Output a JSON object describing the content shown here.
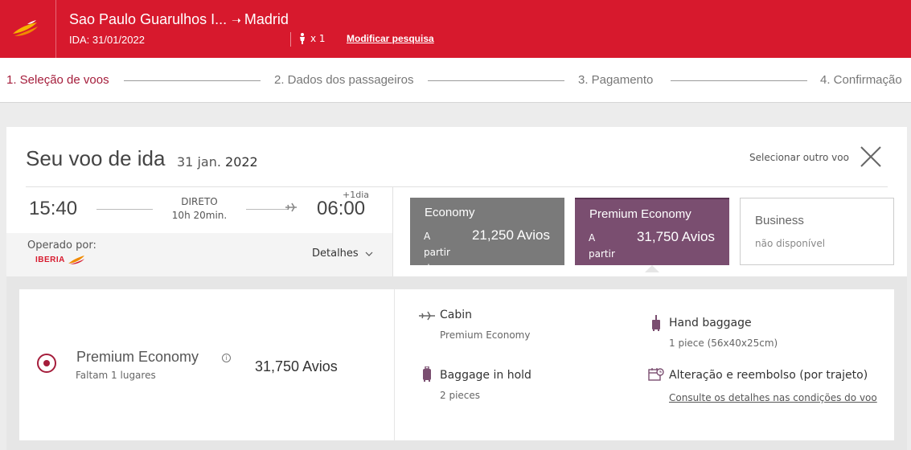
{
  "header": {
    "origin": "Sao Paulo Guarulhos I...",
    "arrow": "➝",
    "destination": "Madrid",
    "ida_date": "IDA: 31/01/2022",
    "passengers": "x 1",
    "modify_label": "Modificar pesquisa"
  },
  "steps": [
    {
      "label": "1. Seleção de voos",
      "active": true
    },
    {
      "label": "2. Dados dos passageiros",
      "active": false
    },
    {
      "label": "3. Pagamento",
      "active": false
    },
    {
      "label": "4. Confirmação",
      "active": false
    }
  ],
  "flight": {
    "title": "Seu voo de ida",
    "date_day_month": "31 jan.",
    "date_year": "2022",
    "select_other_label": "Selecionar outro voo",
    "departure_time": "15:40",
    "arrival_time": "06:00",
    "plus_day": "+1dia",
    "type": "DIRETO",
    "duration": "10h 20min.",
    "operated_by_label": "Operado por:",
    "operator_logo_text": "IBERIA",
    "details_label": "Detalhes"
  },
  "fares": {
    "economy": {
      "name": "Economy",
      "from_label": "A partir de",
      "price": "21,250 Avios"
    },
    "premium": {
      "name": "Premium Economy",
      "from_label": "A partir de",
      "price": "31,750 Avios"
    },
    "business": {
      "name": "Business",
      "status": "não disponível"
    }
  },
  "selected_fare": {
    "name": "Premium Economy",
    "info_glyph": "i",
    "seats_left": "Faltam 1 lugares",
    "price": "31,750 Avios"
  },
  "features": {
    "cabin": {
      "title": "Cabin",
      "value": "Premium Economy"
    },
    "hand_baggage": {
      "title": "Hand baggage",
      "value": "1 piece (56x40x25cm)"
    },
    "hold_baggage": {
      "title": "Baggage in hold",
      "value": "2 pieces"
    },
    "change_refund": {
      "title": "Alteração e reembolso (por trajeto)",
      "link": "Consulte os detalhes nas condições do voo"
    }
  },
  "colors": {
    "brand_red": "#d7192d",
    "active_step": "#a51d3b",
    "economy_bg": "#7a7a7a",
    "premium_bg": "#7a4e70"
  }
}
